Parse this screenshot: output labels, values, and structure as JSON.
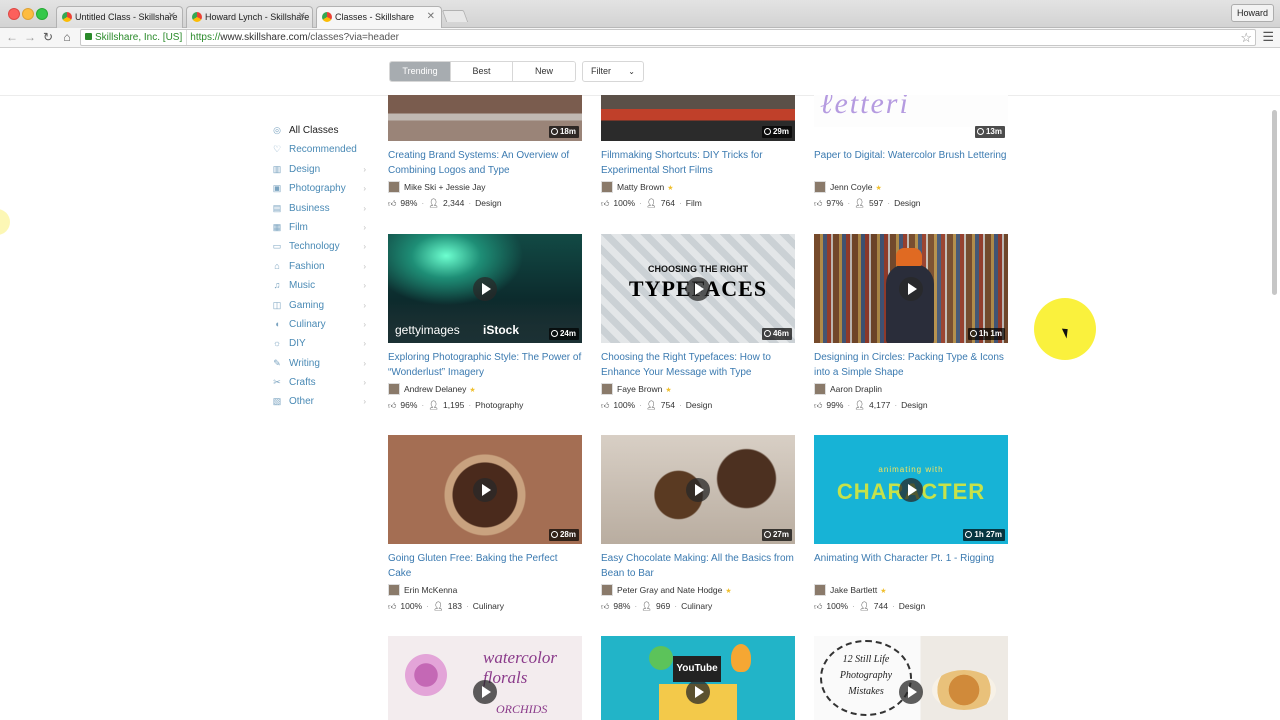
{
  "browser": {
    "tabs": [
      {
        "title": "Untitled Class - Skillshare"
      },
      {
        "title": "Howard Lynch - Skillshare"
      },
      {
        "title": "Classes - Skillshare"
      }
    ],
    "profile": "Howard",
    "security_label": "Skillshare, Inc. [US]",
    "url_proto": "https://",
    "url_host": "www.skillshare.com",
    "url_path": "/classes?via=header"
  },
  "sort": {
    "tabs": [
      "Trending",
      "Best",
      "New"
    ],
    "filter_label": "Filter"
  },
  "sidebar": {
    "items": [
      {
        "label": "All Classes",
        "icon": "compass-icon"
      },
      {
        "label": "Recommended",
        "icon": "heart-icon"
      },
      {
        "label": "Design",
        "icon": "ruler-icon"
      },
      {
        "label": "Photography",
        "icon": "camera-icon"
      },
      {
        "label": "Business",
        "icon": "chart-icon"
      },
      {
        "label": "Film",
        "icon": "film-icon"
      },
      {
        "label": "Technology",
        "icon": "monitor-icon"
      },
      {
        "label": "Fashion",
        "icon": "shirt-icon"
      },
      {
        "label": "Music",
        "icon": "music-icon"
      },
      {
        "label": "Gaming",
        "icon": "gamepad-icon"
      },
      {
        "label": "Culinary",
        "icon": "cup-icon"
      },
      {
        "label": "DIY",
        "icon": "bulb-icon"
      },
      {
        "label": "Writing",
        "icon": "pencil-icon"
      },
      {
        "label": "Crafts",
        "icon": "scissors-icon"
      },
      {
        "label": "Other",
        "icon": "box-icon"
      }
    ]
  },
  "cards": [
    {
      "title": "Creating Brand Systems: An Overview of Combining Logos and Type",
      "author": "Mike Ski + Jessie Jay",
      "star": false,
      "rating": "98%",
      "students": "2,344",
      "category": "Design",
      "duration": "18m"
    },
    {
      "title": "Filmmaking Shortcuts: DIY Tricks for Experimental Short Films",
      "author": "Matty Brown",
      "star": true,
      "rating": "100%",
      "students": "764",
      "category": "Film",
      "duration": "29m"
    },
    {
      "title": "Paper to Digital: Watercolor Brush Lettering",
      "author": "Jenn Coyle",
      "star": true,
      "rating": "97%",
      "students": "597",
      "category": "Design",
      "duration": "13m"
    },
    {
      "title": "Exploring Photographic Style: The Power of “Wonderlust” Imagery",
      "author": "Andrew Delaney",
      "star": true,
      "rating": "96%",
      "students": "1,195",
      "category": "Photography",
      "duration": "24m"
    },
    {
      "title": "Choosing the Right Typefaces: How to Enhance Your Message with Type",
      "author": "Faye Brown",
      "star": true,
      "rating": "100%",
      "students": "754",
      "category": "Design",
      "duration": "46m"
    },
    {
      "title": "Designing in Circles: Packing Type & Icons into a Simple Shape",
      "author": "Aaron Draplin",
      "star": false,
      "rating": "99%",
      "students": "4,177",
      "category": "Design",
      "duration": "1h 1m"
    },
    {
      "title": "Going Gluten Free: Baking the Perfect Cake",
      "author": "Erin McKenna",
      "star": false,
      "rating": "100%",
      "students": "183",
      "category": "Culinary",
      "duration": "28m"
    },
    {
      "title": "Easy Chocolate Making: All the Basics from Bean to Bar",
      "author": "Peter Gray and Nate Hodge",
      "star": true,
      "rating": "98%",
      "students": "969",
      "category": "Culinary",
      "duration": "27m"
    },
    {
      "title": "Animating With Character Pt. 1 - Rigging",
      "author": "Jake Bartlett",
      "star": true,
      "rating": "100%",
      "students": "744",
      "category": "Design",
      "duration": "1h 27m"
    }
  ],
  "thumb_text": {
    "watermark_left": "gettyimages",
    "watermark_right": "iStock",
    "typefaces_top": "CHOOSING THE RIGHT",
    "typefaces_main": "TYPEFACES",
    "animating_top": "animating with",
    "animating_main": "CHARACTER",
    "watercolor": "watercolor florals",
    "orchids": "ORCHIDS",
    "youtube": "YouTube",
    "still_life": "12 Still Life Photography Mistakes"
  }
}
